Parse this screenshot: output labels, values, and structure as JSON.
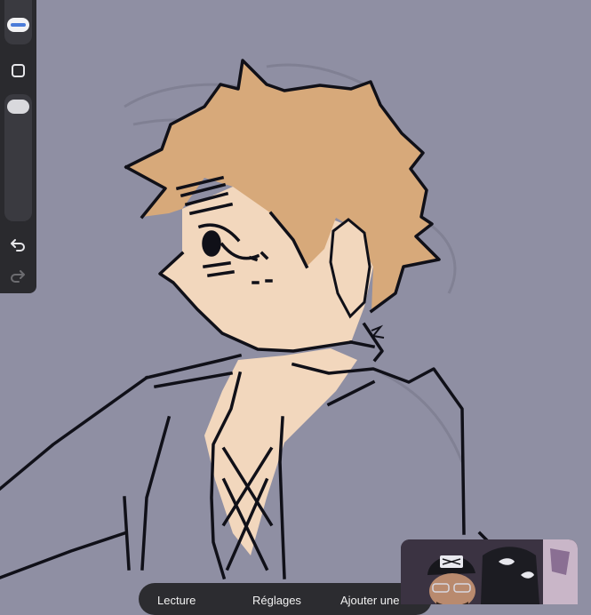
{
  "bottom_bar": {
    "items": [
      {
        "label": "Lecture"
      },
      {
        "label": "Réglages"
      },
      {
        "label": "Ajouter une"
      }
    ]
  },
  "sidebar": {
    "tools": [
      "brush-size-slider",
      "color-square-button",
      "opacity-slider",
      "undo-button",
      "redo-button"
    ]
  },
  "colors": {
    "canvas": "#8f8fa3",
    "hair": "#d7a97a",
    "skin": "#f2d7bd",
    "line": "#101018",
    "toolbar": "#2a2a2e",
    "accent": "#4b7bd8"
  }
}
